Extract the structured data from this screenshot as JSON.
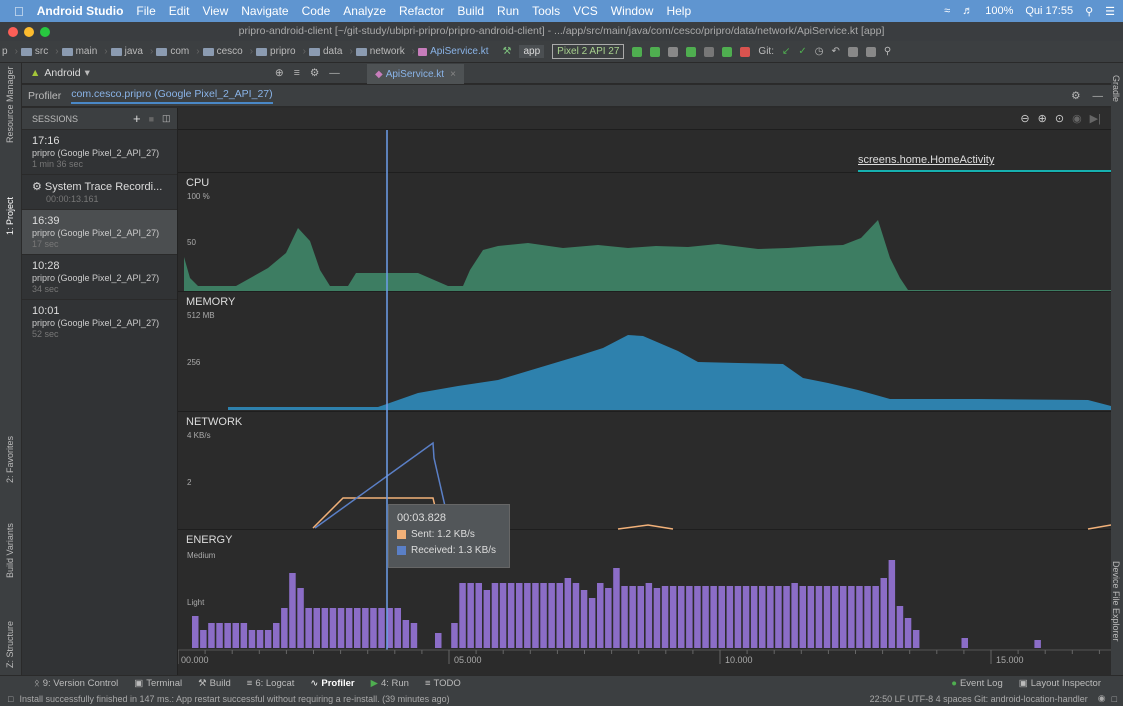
{
  "menubar": {
    "app": "Android Studio",
    "items": [
      "File",
      "Edit",
      "View",
      "Navigate",
      "Code",
      "Analyze",
      "Refactor",
      "Build",
      "Run",
      "Tools",
      "VCS",
      "Window",
      "Help"
    ],
    "battery": "100%",
    "clock": "Qui 17:55"
  },
  "window_title": "pripro-android-client [~/git-study/ubipri-pripro/pripro-android-client] - .../app/src/main/java/com/cesco/pripro/data/network/ApiService.kt [app]",
  "breadcrumbs": [
    "p",
    "src",
    "main",
    "java",
    "com",
    "cesco",
    "pripro",
    "data",
    "network",
    "ApiService.kt"
  ],
  "toolbar": {
    "app_config": "app",
    "device": "Pixel 2 API 27",
    "git_label": "Git:"
  },
  "project_view": {
    "label": "Android"
  },
  "editor_tab": "ApiService.kt",
  "profiler": {
    "tab_label": "Profiler",
    "process": "com.cesco.pripro (Google Pixel_2_API_27)"
  },
  "sessions": {
    "header": "SESSIONS",
    "items": [
      {
        "time": "17:16",
        "name": "pripro (Google Pixel_2_API_27)",
        "duration": "1 min 36 sec"
      },
      {
        "time": "System Trace Recordi...",
        "name": "",
        "duration": "00:00:13.161"
      },
      {
        "time": "16:39",
        "name": "pripro (Google Pixel_2_API_27)",
        "duration": "17 sec"
      },
      {
        "time": "10:28",
        "name": "pripro (Google Pixel_2_API_27)",
        "duration": "34 sec"
      },
      {
        "time": "10:01",
        "name": "pripro (Google Pixel_2_API_27)",
        "duration": "52 sec"
      }
    ]
  },
  "activity": "screens.home.HomeActivity",
  "cpu": {
    "title": "CPU",
    "y_max": "100 %",
    "y_mid": "50"
  },
  "memory": {
    "title": "MEMORY",
    "y_max": "512 MB",
    "y_mid": "256"
  },
  "network": {
    "title": "NETWORK",
    "y_max": "4 KB/s",
    "y_mid": "2"
  },
  "energy": {
    "title": "ENERGY",
    "y_max": "Medium",
    "y_mid": "Light"
  },
  "timeline": {
    "ticks": [
      "00.000",
      "05.000",
      "10.000",
      "15.000"
    ]
  },
  "tooltip": {
    "time": "00:03.828",
    "sent": "Sent: 1.2 KB/s",
    "received": "Received: 1.3 KB/s"
  },
  "colors": {
    "cpu": "#3d7d62",
    "memory": "#2e81ad",
    "sent": "#f2b179",
    "received": "#5a7fc6",
    "energy": "#8b6dc7",
    "cursor": "#6d9eea",
    "activity": "#16b1b0"
  },
  "left_tools": [
    "Resource Manager",
    "1: Project",
    "2: Favorites",
    "Build Variants",
    "Z: Structure"
  ],
  "right_tools": [
    "Gradle",
    "Device File Explorer"
  ],
  "bottom_tools": [
    "9: Version Control",
    "Terminal",
    "Build",
    "6: Logcat",
    "Profiler",
    "4: Run",
    "TODO",
    "Event Log",
    "Layout Inspector"
  ],
  "status": {
    "message": "Install successfully finished in 147 ms.: App restart successful without requiring a re-install. (39 minutes ago)",
    "right": "22:50   LF   UTF-8   4 spaces   Git: android-location-handler"
  }
}
